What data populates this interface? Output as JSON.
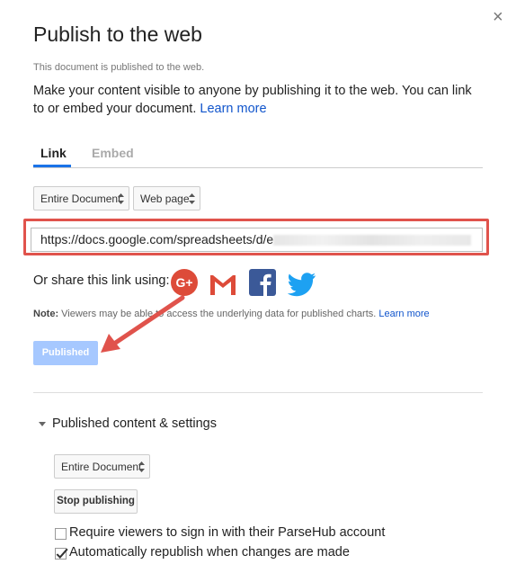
{
  "dialog": {
    "title": "Publish to the web",
    "close_symbol": "×",
    "status": "This document is published to the web.",
    "description": "Make your content visible to anyone by publishing it to the web. You can link to or embed your document. ",
    "learn_more": "Learn more"
  },
  "tabs": [
    {
      "label": "Link",
      "active": true
    },
    {
      "label": "Embed",
      "active": false
    }
  ],
  "selects": {
    "scope": "Entire Document",
    "format": "Web page"
  },
  "url": {
    "value": "https://docs.google.com/spreadsheets/d/e"
  },
  "share": {
    "label": "Or share this link using:",
    "icons": [
      "google-plus-icon",
      "gmail-icon",
      "facebook-icon",
      "twitter-icon"
    ]
  },
  "note": {
    "prefix": "Note:",
    "text": " Viewers may be able to access the underlying data for published charts. ",
    "learn_more": "Learn more"
  },
  "published_button": "Published",
  "settings": {
    "title": "Published content & settings",
    "scope": "Entire Document",
    "stop_button": "Stop publishing",
    "options": [
      {
        "label": "Require viewers to sign in with their ParseHub account",
        "checked": false
      },
      {
        "label": "Automatically republish when changes are made",
        "checked": true
      }
    ]
  },
  "colors": {
    "accent": "#1a73e8",
    "link": "#1155cc",
    "highlight": "#e0534c",
    "published_button": "#a6c8ff"
  }
}
